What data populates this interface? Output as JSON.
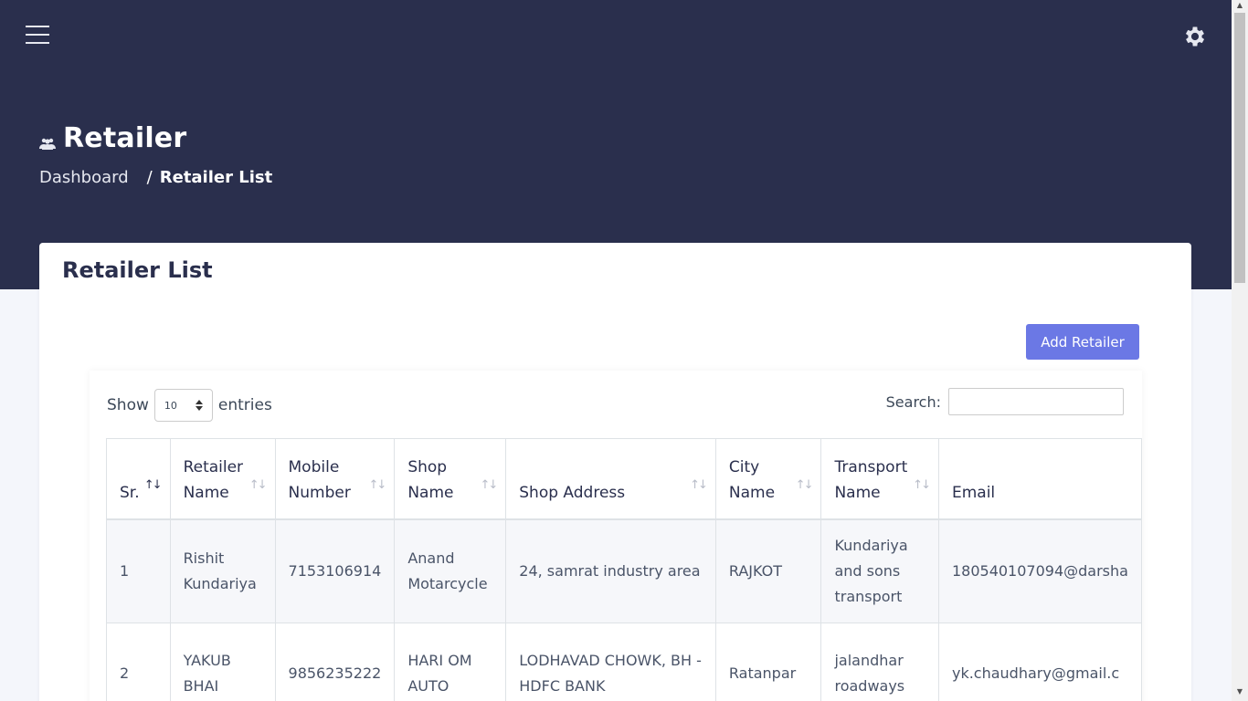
{
  "header": {
    "page_title": "Retailer",
    "breadcrumb": {
      "home": "Dashboard",
      "separator": "/",
      "current": "Retailer List"
    }
  },
  "card": {
    "title": "Retailer List",
    "add_button": "Add Retailer"
  },
  "table_controls": {
    "show_label": "Show",
    "entries_value": "10",
    "entries_label": "entries",
    "search_label": "Search:"
  },
  "columns": [
    {
      "lines": [
        "Sr."
      ],
      "sorted": "asc"
    },
    {
      "lines": [
        "Retailer",
        "Name"
      ]
    },
    {
      "lines": [
        "Mobile",
        "Number"
      ]
    },
    {
      "lines": [
        "Shop",
        "Name"
      ]
    },
    {
      "lines": [
        "Shop Address"
      ]
    },
    {
      "lines": [
        "City",
        "Name"
      ]
    },
    {
      "lines": [
        "Transport",
        "Name"
      ]
    },
    {
      "lines": [
        "Email"
      ]
    }
  ],
  "rows": [
    {
      "sr": "1",
      "retailer_name": [
        "Rishit",
        "Kundariya"
      ],
      "mobile": "7153106914",
      "shop_name": [
        "Anand",
        "Motarcycle"
      ],
      "shop_address": [
        "24, samrat industry area"
      ],
      "city": "RAJKOT",
      "transport": [
        "Kundariya",
        "and sons",
        "transport"
      ],
      "email": "180540107094@darsha"
    },
    {
      "sr": "2",
      "retailer_name": [
        "YAKUB",
        "BHAI"
      ],
      "mobile": "9856235222",
      "shop_name": [
        "HARI OM",
        "AUTO"
      ],
      "shop_address": [
        "LODHAVAD CHOWK, BH -",
        "HDFC BANK"
      ],
      "city": "Ratanpar",
      "transport": [
        "jalandhar",
        "roadways"
      ],
      "email": "yk.chaudhary@gmail.c"
    }
  ],
  "colors": {
    "header_bg": "#2a2f4d",
    "accent": "#6b78e5",
    "page_bg": "#f4f6fb"
  },
  "icons": {
    "menu": "hamburger-icon",
    "settings": "gear-icon",
    "title": "users-icon"
  }
}
